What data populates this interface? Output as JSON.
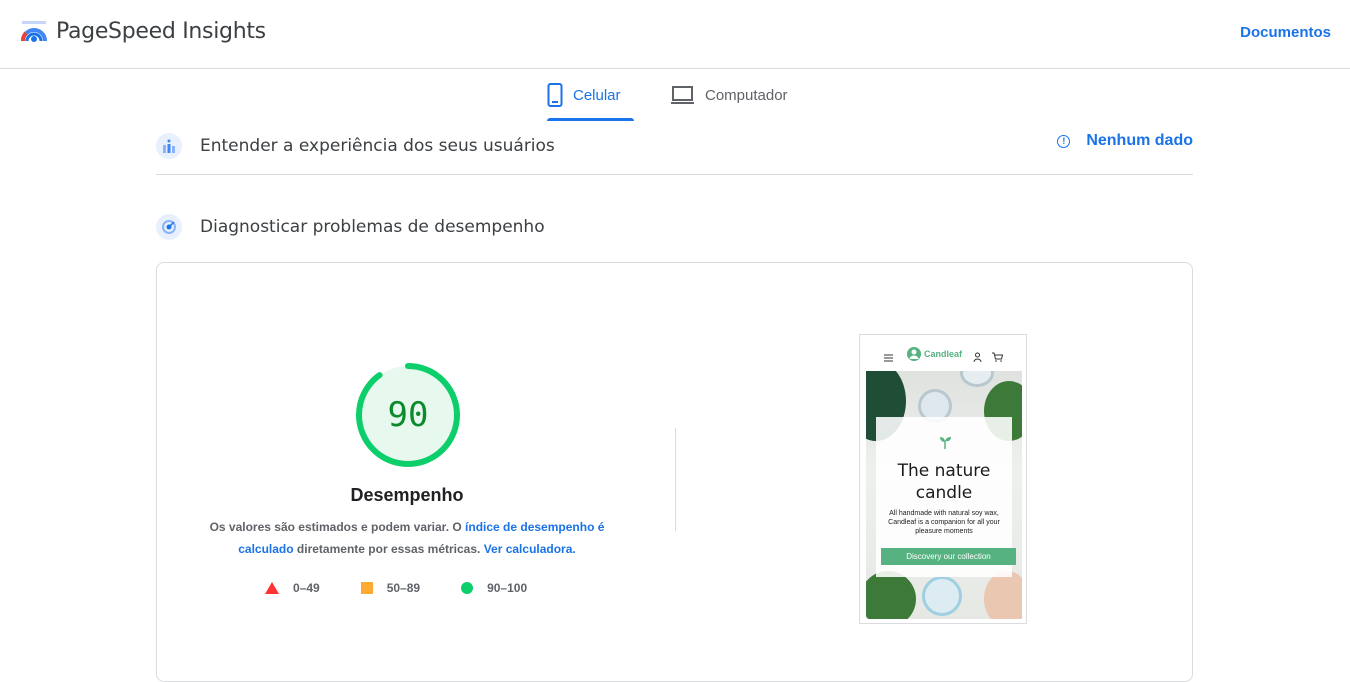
{
  "header": {
    "app_title": "PageSpeed Insights",
    "docs_label": "Documentos"
  },
  "tabs": [
    {
      "label": "Celular",
      "active": true,
      "icon": "phone-icon"
    },
    {
      "label": "Computador",
      "active": false,
      "icon": "laptop-icon"
    }
  ],
  "user_experience": {
    "title": "Entender a experiência dos seus usuários",
    "status": "Nenhum dado",
    "info_glyph": "!"
  },
  "diagnose": {
    "title": "Diagnosticar problemas de desempenho"
  },
  "performance": {
    "score": "90",
    "score_fraction": 0.9,
    "title": "Desempenho",
    "desc_1": "Os valores são estimados e podem variar. O ",
    "link_1": "índice de desempenho é calculado",
    "desc_2": " diretamente por essas métricas. ",
    "link_2": "Ver calculadora.",
    "legend": [
      {
        "label": "0–49",
        "color": "#ff3333",
        "shape": "triangle"
      },
      {
        "label": "50–89",
        "color": "#ffaa33",
        "shape": "square"
      },
      {
        "label": "90–100",
        "color": "#0cce6b",
        "shape": "circle"
      }
    ]
  },
  "screenshot": {
    "brand": "Candleaf",
    "hero_title": "The nature candle",
    "hero_sub": "All handmade with natural soy wax, Candleaf is a companion for all your pleasure moments",
    "cta": "Discovery our collection"
  },
  "colors": {
    "accent": "#1a73e8",
    "pass": "#0cce6b",
    "score_text": "#0d8a2b"
  }
}
